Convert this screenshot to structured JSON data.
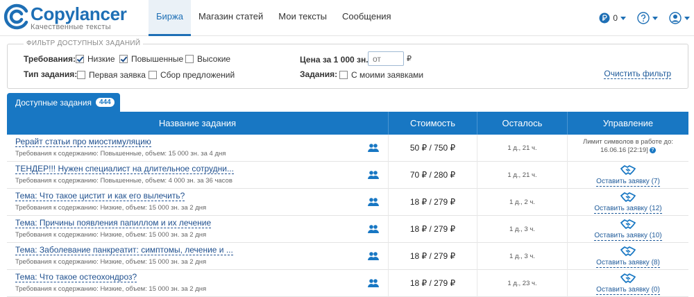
{
  "logo": {
    "name": "Copylancer",
    "tagline": "Качественные тексты"
  },
  "nav": [
    "Биржа",
    "Магазин статей",
    "Мои тексты",
    "Сообщения"
  ],
  "header": {
    "balance": "0"
  },
  "filter": {
    "legend": "ФИЛЬТР ДОСТУПНЫХ ЗАДАНИЙ",
    "requirements_label": "Требования:",
    "requirements": [
      {
        "label": "Низкие",
        "checked": true
      },
      {
        "label": "Повышенные",
        "checked": true
      },
      {
        "label": "Высокие",
        "checked": false
      }
    ],
    "task_type_label": "Тип задания:",
    "task_types": [
      {
        "label": "Первая заявка",
        "checked": false
      },
      {
        "label": "Сбор предложений",
        "checked": false
      }
    ],
    "price_label": "Цена за 1 000 зн.:",
    "price_placeholder": "от",
    "price_currency": "₽",
    "tasks_label": "Задания:",
    "tasks_option": {
      "label": "С моими заявками",
      "checked": false
    },
    "clear_label": "Очистить фильтр"
  },
  "tab": {
    "label": "Доступные задания",
    "count": "444"
  },
  "table": {
    "columns": [
      "Название задания",
      "Стоимость",
      "Осталось",
      "Управление"
    ],
    "rows": [
      {
        "title": "Рерайт статьи про миостимуляцию",
        "req": "Требования к содержанию: Повышенные, объем: 15 000 зн. за 4 дня",
        "cost": "50 ₽ / 750 ₽",
        "left": "1 д., 21 ч.",
        "limit_line1": "Лимит символов в работе до:",
        "limit_line2": "16.06.16 [22:19]"
      },
      {
        "title": "ТЕНДЕР!!! Нужен специалист на длительное сотрудни...",
        "req": "Требования к содержанию: Повышенные, объем: 4 000 зн. за 36 часов",
        "cost": "70 ₽ / 280 ₽",
        "left": "1 д., 21 ч.",
        "action": "Оставить заявку (7)"
      },
      {
        "title": "Тема: Что такое цистит и как его вылечить?",
        "req": "Требования к содержанию: Низкие, объем: 15 000 зн. за 2 дня",
        "cost": "18 ₽ / 279 ₽",
        "left": "1 д., 2 ч.",
        "action": "Оставить заявку (12)"
      },
      {
        "title": "Тема: Причины появления папиллом и их лечение",
        "req": "Требования к содержанию: Низкие, объем: 15 000 зн. за 2 дня",
        "cost": "18 ₽ / 279 ₽",
        "left": "1 д., 3 ч.",
        "action": "Оставить заявку (10)"
      },
      {
        "title": "Тема: Заболевание панкреатит: симптомы, лечение и ...",
        "req": "Требования к содержанию: Низкие, объем: 15 000 зн. за 2 дня",
        "cost": "18 ₽ / 279 ₽",
        "left": "1 д., 3 ч.",
        "action": "Оставить заявку (8)"
      },
      {
        "title": "Тема: Что такое остеохондроз?",
        "req": "Требования к содержанию: Низкие, объем: 15 000 зн. за 2 дня",
        "cost": "18 ₽ / 279 ₽",
        "left": "1 д., 23 ч.",
        "action": "Оставить заявку (0)"
      }
    ]
  },
  "colors": {
    "primary": "#1877c3",
    "brand": "#1e6fb5",
    "link": "#1e4f8e"
  }
}
